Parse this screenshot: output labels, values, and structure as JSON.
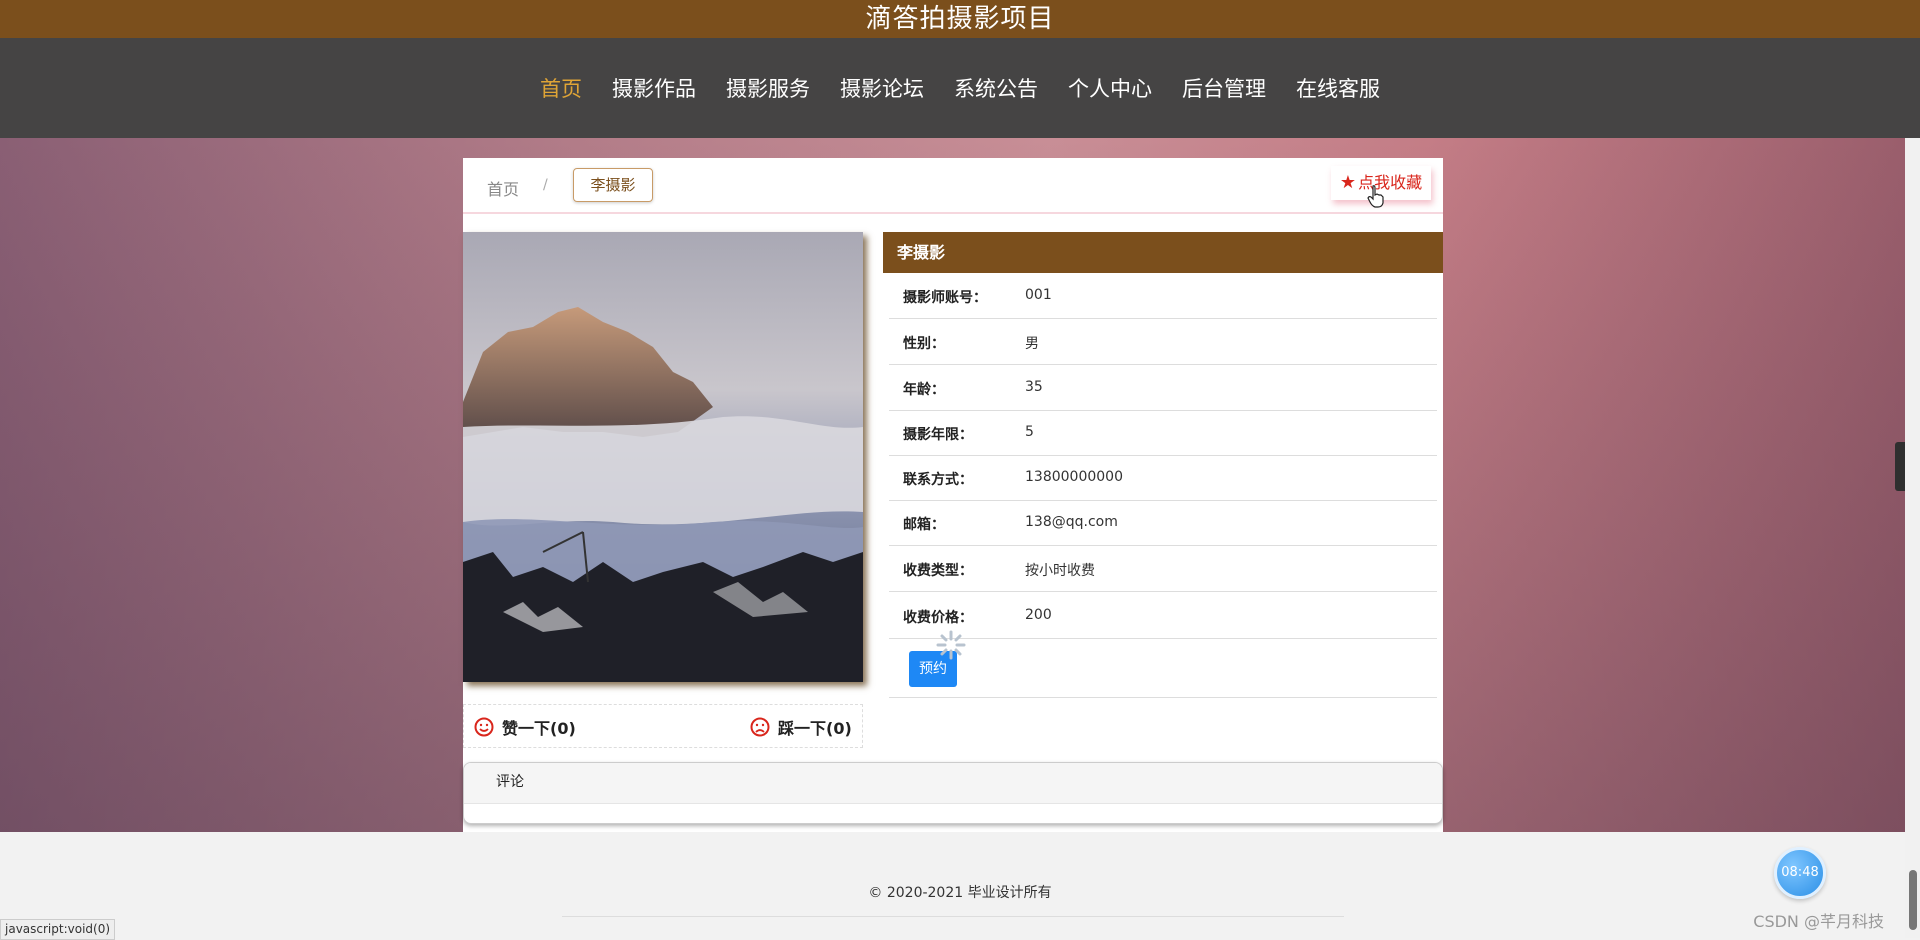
{
  "site": {
    "title": "滴答拍摄影项目"
  },
  "nav": {
    "items": [
      {
        "label": "首页",
        "active": true
      },
      {
        "label": "摄影作品"
      },
      {
        "label": "摄影服务"
      },
      {
        "label": "摄影论坛"
      },
      {
        "label": "系统公告"
      },
      {
        "label": "个人中心"
      },
      {
        "label": "后台管理"
      },
      {
        "label": "在线客服"
      }
    ]
  },
  "breadcrumb": {
    "home": "首页",
    "sep": "/",
    "current": "李摄影"
  },
  "favorite": {
    "icon": "star-icon",
    "label": "点我收藏"
  },
  "detail": {
    "title": "李摄影",
    "rows": [
      {
        "label": "摄影师账号：",
        "value": "001"
      },
      {
        "label": "性别：",
        "value": "男"
      },
      {
        "label": "年龄：",
        "value": "35"
      },
      {
        "label": "摄影年限：",
        "value": "5"
      },
      {
        "label": "联系方式：",
        "value": "13800000000"
      },
      {
        "label": "邮箱：",
        "value": "138@qq.com"
      },
      {
        "label": "收费类型：",
        "value": "按小时收费"
      },
      {
        "label": "收费价格：",
        "value": "200"
      }
    ],
    "book_label": "预约"
  },
  "votes": {
    "like": "赞一下(0)",
    "dislike": "踩一下(0)"
  },
  "comments": {
    "header": "评论"
  },
  "footer": {
    "copyright": "© 2020-2021 毕业设计所有"
  },
  "status": {
    "url": "javascript:void(0)"
  },
  "watermark": "CSDN @芊月科技",
  "clock": "08:48",
  "colors": {
    "brand": "#7b4f1c",
    "nav_bg": "#454444",
    "active_nav": "#e0a536",
    "fav": "#d9261c",
    "button": "#1e88f5"
  }
}
